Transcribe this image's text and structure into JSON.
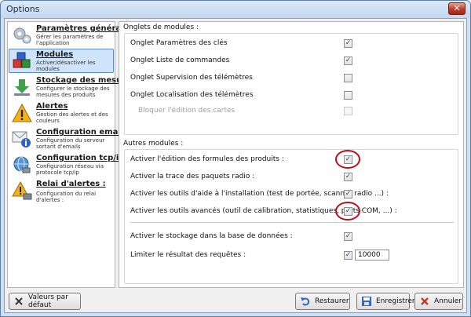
{
  "window": {
    "title": "Options",
    "close_glyph": "✕"
  },
  "sidebar": {
    "items": [
      {
        "title": "Paramètres généraux",
        "desc": "Gérer les paramètres de l'application",
        "icon": "gears-icon"
      },
      {
        "title": "Modules",
        "desc": "Activer/désactiver les modules",
        "icon": "cubes-icon",
        "active": true
      },
      {
        "title": "Stockage des mesures",
        "desc": "Configurer le stockage des mesures des produits",
        "icon": "download-icon"
      },
      {
        "title": "Alertes",
        "desc": "Gestion des alertes et des couleurs",
        "icon": "warning-icon"
      },
      {
        "title": "Configuration email",
        "desc": "Configuration du serveur sortant d'emails",
        "icon": "email-icon"
      },
      {
        "title": "Configuration tcp/ip",
        "desc": "Configuration réseau via protocole tcp/ip",
        "icon": "network-icon"
      },
      {
        "title": "Relai d'alertes :",
        "desc": "Configuration du relai d'alertes :",
        "icon": "relay-icon"
      }
    ]
  },
  "onglets": {
    "title": "Onglets de modules :",
    "rows": [
      {
        "label": "Onglet Paramètres des clés",
        "checked": true
      },
      {
        "label": "Onglet Liste de commandes",
        "checked": true
      },
      {
        "label": "Onglet Supervision des télémètres",
        "checked": false
      },
      {
        "label": "Onglet Localisation des télémètres",
        "checked": false
      },
      {
        "label": "Bloquer l'édition des cartes",
        "checked": false,
        "disabled": true
      }
    ]
  },
  "autres": {
    "title": "Autres modules :",
    "rows": [
      {
        "label": "Activer l'édition des formules des produits :",
        "checked": true
      },
      {
        "label": "Activer la trace des paquets radio :",
        "checked": true
      },
      {
        "label": "Activer les outils d'aide à l'installation (test de portée, scanner radio ...) :",
        "checked": true
      },
      {
        "label": "Activer les outils avancés (outil de calibration, statistiques, ports COM, ...) :",
        "checked": true
      },
      {
        "label": "Activer le stockage dans la base de données :",
        "checked": true
      },
      {
        "label": "Limiter le résultat des requêtes :",
        "checked": true
      }
    ],
    "limit_value": "10000"
  },
  "footer": {
    "default_label": "Valeurs par défaut",
    "restore_label": "Restaurer",
    "save_label": "Enregistrer*",
    "cancel_label": "Annuler"
  },
  "check_glyph": "✓"
}
